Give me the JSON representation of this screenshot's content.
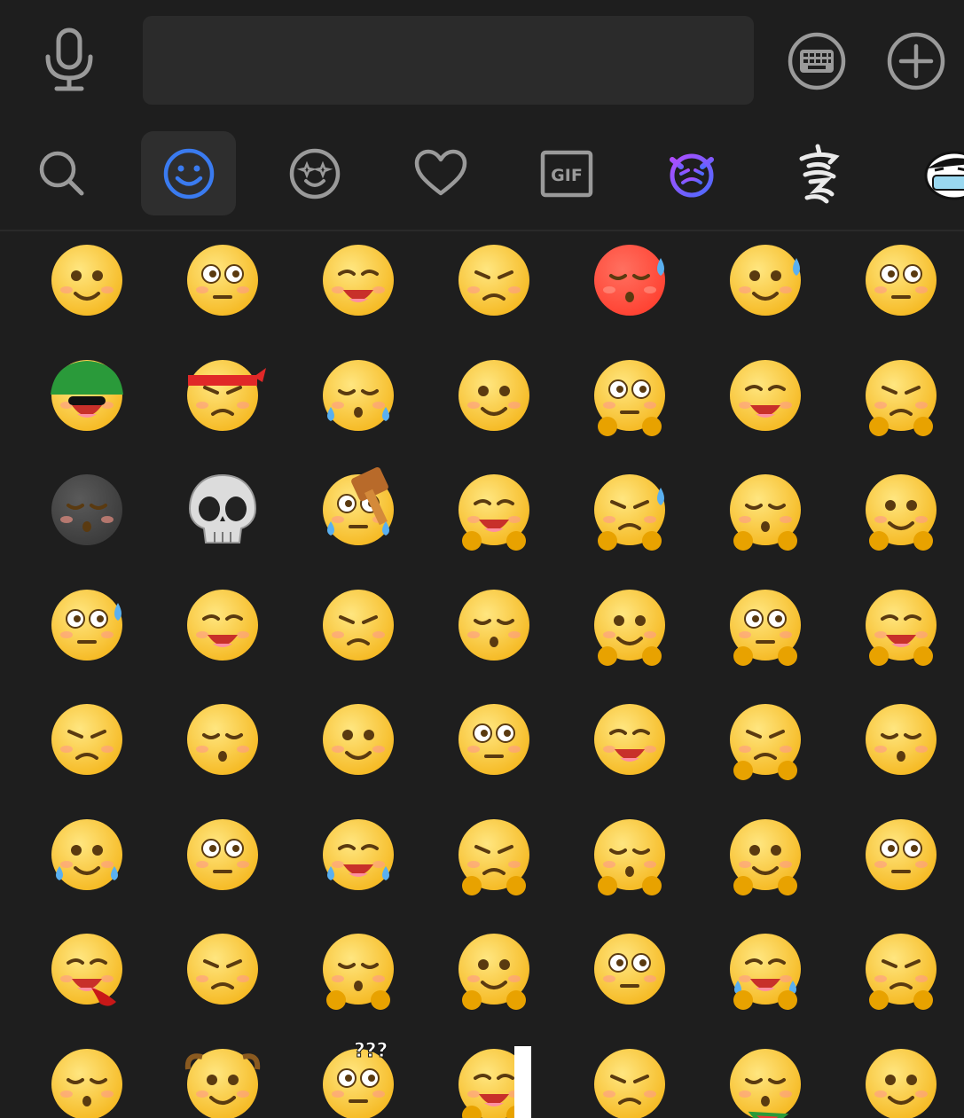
{
  "input": {
    "value": "",
    "placeholder": ""
  },
  "tabs": [
    {
      "name": "search",
      "icon": "search-icon"
    },
    {
      "name": "emoji",
      "icon": "smiley-icon",
      "active": true
    },
    {
      "name": "animated",
      "icon": "sparkle-smiley-icon"
    },
    {
      "name": "favorites",
      "icon": "heart-icon"
    },
    {
      "name": "gif",
      "icon": "gif-icon",
      "label": "GIF"
    },
    {
      "name": "sticker-pack-1",
      "icon": "purple-cat-sticker-icon"
    },
    {
      "name": "sticker-pack-2",
      "icon": "calligraphy-sticker-icon"
    },
    {
      "name": "sticker-pack-3",
      "icon": "masked-face-sticker-icon"
    }
  ],
  "colors": {
    "accent": "#3a7bf0",
    "icon_gray": "#9a9a9a",
    "emoji_yellow": "#ffd24a",
    "background": "#1e1e1e"
  },
  "emojis": [
    "surprised",
    "thinking",
    "drool",
    "meh",
    "shocked-red",
    "sweat-sigh",
    "grin",
    "green-hat",
    "tough",
    "angry-shout",
    "puzzled",
    "shh",
    "dizzy",
    "struggle",
    "bomb",
    "skull",
    "hammer",
    "blush-hold",
    "facepalm-sweat",
    "yawn-cover",
    "shy-cover",
    "nervous-sweat",
    "big-grin",
    "side-look",
    "side-look-2",
    "yawn",
    "pout-arms",
    "worried-hands",
    "sad",
    "smirk",
    "kiss",
    "kiss-2",
    "shocked",
    "teary-eyes",
    "wink-tongue",
    "laugh-cry",
    "cute",
    "ugh-cry",
    "cheer",
    "shy",
    "joy",
    "smug-roll",
    "nosebleed",
    "smile-soft",
    "hands-up",
    "hand-face",
    "dim",
    "laugh-cover",
    "typing",
    "sick",
    "bald",
    "question",
    "peek",
    "gentle",
    "melon",
    "upside"
  ]
}
